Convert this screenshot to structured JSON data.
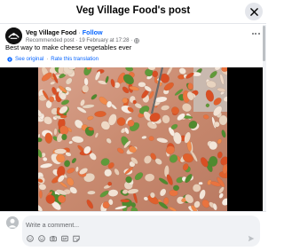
{
  "dialog": {
    "title": "Veg Village Food's post"
  },
  "post": {
    "author": "Veg Village Food",
    "separator": "·",
    "follow_label": "Follow",
    "meta": "Recommended post · 19 February at 17:28 ·",
    "caption": "Best way to make cheese vegetables ever",
    "see_original": "See original",
    "translation_separator": "·",
    "rate_translation": "Rate this translation"
  },
  "comment": {
    "placeholder": "Write a comment..."
  },
  "icons": {
    "close": "close-icon",
    "page_avatar": "page-avatar-logo",
    "globe": "globe-icon",
    "more": "more-options-icon",
    "translate": "translate-icon",
    "sticker": "sticker-icon",
    "emoji": "emoji-icon",
    "camera": "camera-icon",
    "gif": "gif-icon",
    "avatar_sticker": "avatar-sticker-icon",
    "send": "send-icon"
  },
  "colors": {
    "link": "#0866ff",
    "secondary_text": "#65676b",
    "comment_bg": "#f0f2f5",
    "media_bg": "#000000"
  }
}
